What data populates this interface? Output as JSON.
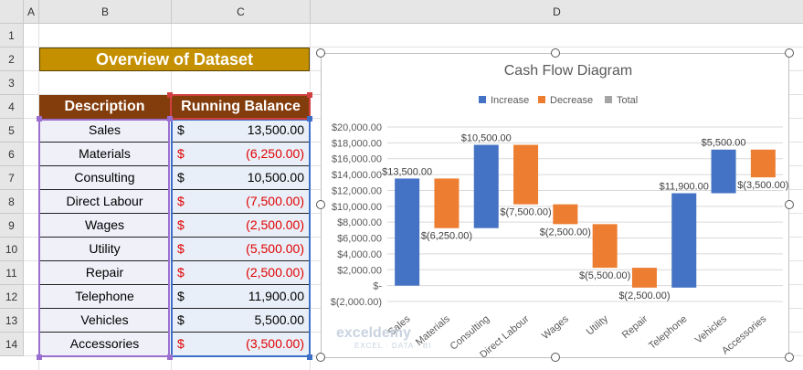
{
  "sheet": {
    "columns": [
      "A",
      "B",
      "C",
      "D"
    ],
    "rows": [
      "1",
      "2",
      "3",
      "4",
      "5",
      "6",
      "7",
      "8",
      "9",
      "10",
      "11",
      "12",
      "13",
      "14"
    ],
    "title": "Overview of Dataset",
    "headers": {
      "description": "Description",
      "balance": "Running Balance"
    },
    "data": [
      {
        "desc": "Sales",
        "cur": "$",
        "amt": "13,500.00",
        "neg": false
      },
      {
        "desc": "Materials",
        "cur": "$",
        "amt": "(6,250.00)",
        "neg": true
      },
      {
        "desc": "Consulting",
        "cur": "$",
        "amt": "10,500.00",
        "neg": false
      },
      {
        "desc": "Direct Labour",
        "cur": "$",
        "amt": "(7,500.00)",
        "neg": true
      },
      {
        "desc": "Wages",
        "cur": "$",
        "amt": "(2,500.00)",
        "neg": true
      },
      {
        "desc": "Utility",
        "cur": "$",
        "amt": "(5,500.00)",
        "neg": true
      },
      {
        "desc": "Repair",
        "cur": "$",
        "amt": "(2,500.00)",
        "neg": true
      },
      {
        "desc": "Telephone",
        "cur": "$",
        "amt": "11,900.00",
        "neg": false
      },
      {
        "desc": "Vehicles",
        "cur": "$",
        "amt": "5,500.00",
        "neg": false
      },
      {
        "desc": "Accessories",
        "cur": "$",
        "amt": "(3,500.00)",
        "neg": true
      }
    ]
  },
  "watermark": {
    "brand": "exceldemy",
    "tagline": "EXCEL · DATA · BI"
  },
  "chart_data": {
    "type": "bar",
    "subtype": "waterfall",
    "title": "Cash Flow Diagram",
    "legend": [
      "Increase",
      "Decrease",
      "Total"
    ],
    "legend_position": "top",
    "colors": {
      "Increase": "#4472c4",
      "Decrease": "#ed7d31",
      "Total": "#a5a5a5"
    },
    "categories": [
      "Sales",
      "Materials",
      "Consulting",
      "Direct Labour",
      "Wages",
      "Utility",
      "Repair",
      "Telephone",
      "Vehicles",
      "Accessories"
    ],
    "values": [
      13500,
      -6250,
      10500,
      -7500,
      -2500,
      -5500,
      -2500,
      11900,
      5500,
      -3500
    ],
    "bars": [
      {
        "start": 0,
        "end": 13500,
        "type": "Increase",
        "label": "$13,500.00"
      },
      {
        "start": 13500,
        "end": 7250,
        "type": "Decrease",
        "label": "$(6,250.00)"
      },
      {
        "start": 7250,
        "end": 17750,
        "type": "Increase",
        "label": "$10,500.00"
      },
      {
        "start": 17750,
        "end": 10250,
        "type": "Decrease",
        "label": "$(7,500.00)"
      },
      {
        "start": 10250,
        "end": 7750,
        "type": "Decrease",
        "label": "$(2,500.00)"
      },
      {
        "start": 7750,
        "end": 2250,
        "type": "Decrease",
        "label": "$(5,500.00)"
      },
      {
        "start": 2250,
        "end": -250,
        "type": "Decrease",
        "label": "$(2,500.00)"
      },
      {
        "start": -250,
        "end": 11650,
        "type": "Increase",
        "label": "$11,900.00"
      },
      {
        "start": 11650,
        "end": 17150,
        "type": "Increase",
        "label": "$5,500.00"
      },
      {
        "start": 17150,
        "end": 13650,
        "type": "Decrease",
        "label": "$(3,500.00)"
      }
    ],
    "y_ticks": [
      {
        "v": 20000,
        "label": "$20,000.00"
      },
      {
        "v": 18000,
        "label": "$18,000.00"
      },
      {
        "v": 16000,
        "label": "$16,000.00"
      },
      {
        "v": 14000,
        "label": "$14,000.00"
      },
      {
        "v": 12000,
        "label": "$12,000.00"
      },
      {
        "v": 10000,
        "label": "$10,000.00"
      },
      {
        "v": 8000,
        "label": "$8,000.00"
      },
      {
        "v": 6000,
        "label": "$6,000.00"
      },
      {
        "v": 4000,
        "label": "$4,000.00"
      },
      {
        "v": 2000,
        "label": "$2,000.00"
      },
      {
        "v": 0,
        "label": "$-"
      },
      {
        "v": -2000,
        "label": "$(2,000.00)"
      }
    ],
    "ylim": [
      -2000,
      20000
    ],
    "grid": true
  }
}
